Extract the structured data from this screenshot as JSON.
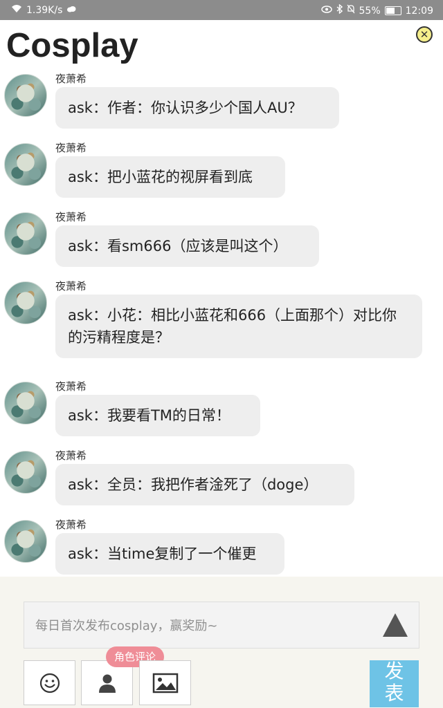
{
  "status_bar": {
    "speed": "1.39K/s",
    "battery": "55%",
    "time": "12:09"
  },
  "header": {
    "title": "Cosplay",
    "close_icon": "close-circle-icon"
  },
  "messages": [
    {
      "sender": "夜萧希",
      "text": "ask：作者：你认识多少个国人AU？"
    },
    {
      "sender": "夜萧希",
      "text": "ask：把小蓝花的视屏看到底"
    },
    {
      "sender": "夜萧希",
      "text": "ask：看sm666（应该是叫这个）"
    },
    {
      "sender": "夜萧希",
      "text": "ask：小花：相比小蓝花和666（上面那个）对比你的污精程度是？"
    },
    {
      "sender": "夜萧希",
      "text": "ask：我要看TM的日常！"
    },
    {
      "sender": "夜萧希",
      "text": "ask：全员：我把作者淦死了（doge）"
    },
    {
      "sender": "夜萧希",
      "text": "ask：当time复制了一个催更"
    }
  ],
  "composer": {
    "placeholder": "每日首次发布cosplay，赢奖励~",
    "role_badge": "角色评论",
    "post_label": "发表",
    "colors": {
      "post": "#6ec3e6",
      "badge": "#ef8d97",
      "background": "#f6f5ef"
    }
  }
}
